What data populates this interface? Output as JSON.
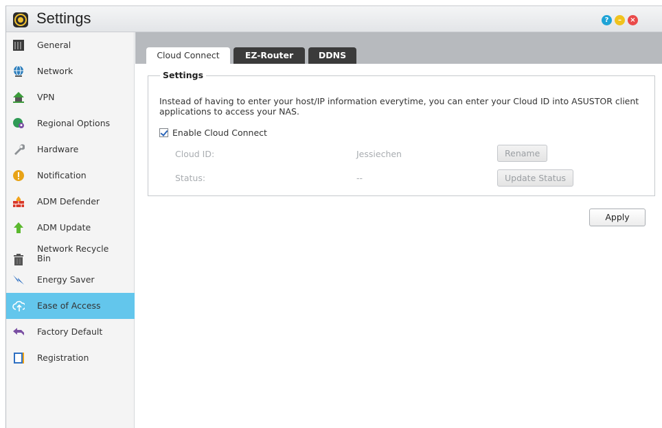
{
  "window": {
    "title": "Settings",
    "controls": [
      "help-icon",
      "minimize-icon",
      "close-icon"
    ]
  },
  "sidebar": {
    "items": [
      {
        "label": "General",
        "icon": "server-icon"
      },
      {
        "label": "Network",
        "icon": "globe-icon"
      },
      {
        "label": "VPN",
        "icon": "house-icon"
      },
      {
        "label": "Regional Options",
        "icon": "map-pin-icon"
      },
      {
        "label": "Hardware",
        "icon": "wrench-icon"
      },
      {
        "label": "Notification",
        "icon": "alert-icon"
      },
      {
        "label": "ADM Defender",
        "icon": "firewall-icon"
      },
      {
        "label": "ADM Update",
        "icon": "arrow-up-icon"
      },
      {
        "label": "Network Recycle Bin",
        "icon": "trash-icon"
      },
      {
        "label": "Energy Saver",
        "icon": "lightning-icon"
      },
      {
        "label": "Ease of Access",
        "icon": "cloud-upload-icon",
        "active": true
      },
      {
        "label": "Factory Default",
        "icon": "undo-icon"
      },
      {
        "label": "Registration",
        "icon": "clipboard-icon"
      }
    ]
  },
  "tabs": [
    {
      "label": "Cloud Connect",
      "active": true
    },
    {
      "label": "EZ-Router",
      "active": false
    },
    {
      "label": "DDNS",
      "active": false
    }
  ],
  "settings": {
    "group_title": "Settings",
    "description": "Instead of having to enter your host/IP information everytime, you can enter your Cloud ID into ASUSTOR client applications to access your NAS.",
    "enable_label": "Enable Cloud Connect",
    "enabled": true,
    "cloud_id_label": "Cloud ID:",
    "cloud_id_value": "Jessiechen",
    "rename_label": "Rename",
    "status_label": "Status:",
    "status_value": "--",
    "update_status_label": "Update Status"
  },
  "apply_label": "Apply",
  "colors": {
    "active_item": "#63c6ec",
    "tab_inactive": "#3b3b3b",
    "tabbar": "#b7babe"
  }
}
